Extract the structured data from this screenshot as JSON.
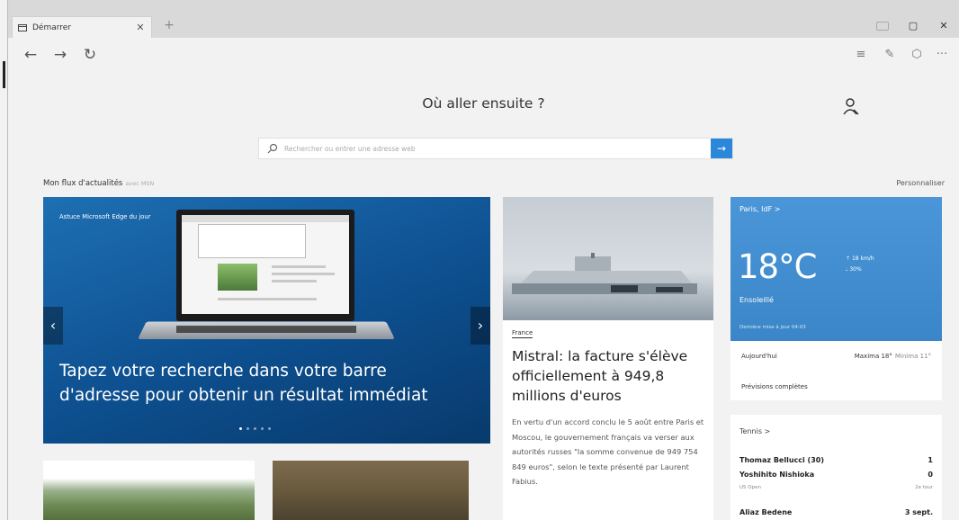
{
  "tab": {
    "title": "Démarrer",
    "close": "✕",
    "new": "+"
  },
  "window": {
    "maximize": "▢",
    "close": "✕"
  },
  "nav": {
    "back": "←",
    "forward": "→",
    "refresh": "↻"
  },
  "toolbar": {
    "hub": "≡",
    "note": "✎",
    "share": "⬡",
    "more": "···"
  },
  "hero": {
    "title": "Où aller ensuite ?"
  },
  "search": {
    "placeholder": "Rechercher ou entrer une adresse web",
    "go": "→"
  },
  "feed": {
    "title": "Mon flux d'actualités",
    "source": "avec MSN",
    "customize": "Personnaliser"
  },
  "carousel": {
    "tag": "Astuce Microsoft Edge du jour",
    "caption": "Tapez votre recherche dans votre barre d'adresse pour obtenir un résultat immédiat",
    "prev": "‹",
    "next": "›",
    "dots": 5,
    "active_dot": 0
  },
  "article": {
    "category": "France",
    "title": "Mistral: la facture s'élève officiellement à 949,8 millions d'euros",
    "body": "En vertu d'un accord conclu le 5 août entre Paris et Moscou, le gouvernement français va verser aux autorités russes \"la somme convenue de 949 754 849 euros\", selon le texte présenté par Laurent Fabius."
  },
  "weather": {
    "city": "Paris, IdF >",
    "temp": "18°C",
    "wind": "18 km/h",
    "humidity": "30%",
    "condition": "Ensoleillé",
    "updated": "Dernière mise à jour 04:03",
    "today": "Aujourd'hui",
    "max": "Maxima 18°",
    "min": "Minima 11°",
    "forecast": "Prévisions complètes"
  },
  "tennis": {
    "title": "Tennis >",
    "players": [
      {
        "name": "Thomaz Bellucci (30)",
        "score": "1"
      },
      {
        "name": "Yoshihito Nishioka",
        "score": "0"
      }
    ],
    "tournament": "US Open",
    "round": "2e tour",
    "next": "Aliaz Bedene",
    "next_time": "3 sept."
  }
}
